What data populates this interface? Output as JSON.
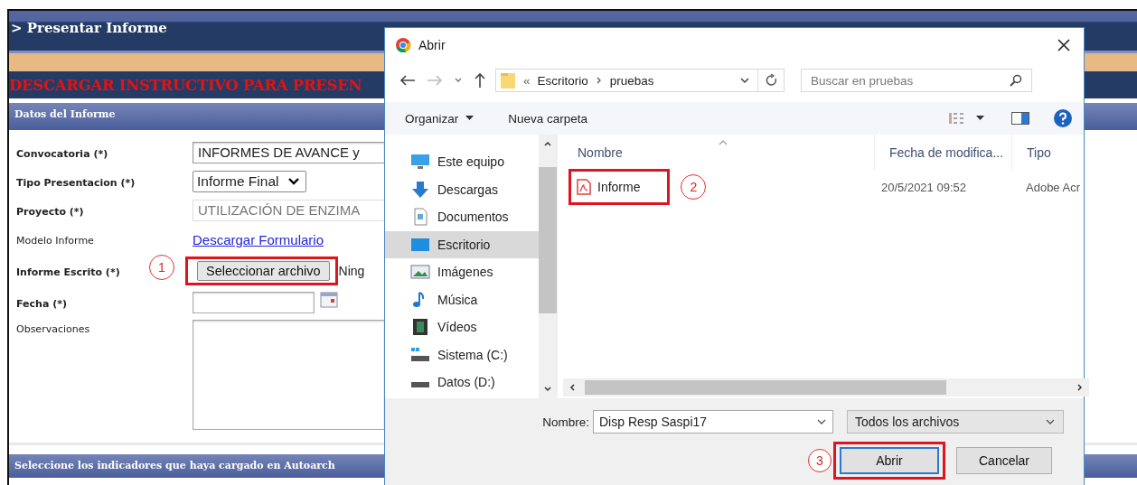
{
  "page": {
    "title": "> Presentar Informe",
    "banner": "DESCARGAR INSTRUCTIVO PARA PRESEN",
    "section": "Datos del Informe",
    "fields": [
      {
        "kind": "text",
        "label": "Convocatoria (*)",
        "bold": true,
        "value": "INFORMES DE AVANCE y"
      },
      {
        "kind": "select",
        "label": "Tipo Presentacion (*)",
        "bold": true,
        "value": "Informe Final"
      },
      {
        "kind": "readonly",
        "label": "Proyecto (*)",
        "bold": true,
        "value": "UTILIZACIÓN DE ENZIMA"
      },
      {
        "kind": "link",
        "label": "Modelo Informe",
        "bold": false,
        "value": "Descargar Formulario"
      },
      {
        "kind": "file",
        "label": "Informe Escrito (*)",
        "bold": true,
        "button": "Seleccionar archivo",
        "value": "Ning"
      },
      {
        "kind": "date",
        "label": "Fecha (*)",
        "bold": true
      },
      {
        "kind": "textarea",
        "label": "Observaciones",
        "bold": false
      }
    ],
    "footer_section": "Seleccione los indicadores que haya cargado en Autoarch"
  },
  "dialog": {
    "title": "Abrir",
    "path_prefix": "«",
    "path": [
      "Escritorio",
      "pruebas"
    ],
    "search": {
      "placeholder": "Buscar en pruebas"
    },
    "toolbar": [
      "Organizar",
      "Nueva carpeta"
    ],
    "sidebar": [
      {
        "kind": "pc",
        "label": "Este equipo",
        "selected": false
      },
      {
        "kind": "download",
        "label": "Descargas",
        "selected": false
      },
      {
        "kind": "docs",
        "label": "Documentos",
        "selected": false
      },
      {
        "kind": "desktop",
        "label": "Escritorio",
        "selected": true
      },
      {
        "kind": "images",
        "label": "Imágenes",
        "selected": false
      },
      {
        "kind": "music",
        "label": "Música",
        "selected": false
      },
      {
        "kind": "videos",
        "label": "Vídeos",
        "selected": false
      },
      {
        "kind": "drive-c",
        "label": "Sistema (C:)",
        "selected": false
      },
      {
        "kind": "drive",
        "label": "Datos (D:)",
        "selected": false
      }
    ],
    "columns": [
      "Nombre",
      "Fecha de modifica...",
      "Tipo"
    ],
    "files": [
      {
        "name": "Informe",
        "date": "20/5/2021 09:52",
        "type": "Adobe Acr"
      }
    ],
    "filename_label": "Nombre:",
    "filename": "Disp Resp Saspi17",
    "filter": "Todos los archivos",
    "buttons": [
      "Abrir",
      "Cancelar"
    ]
  },
  "annotations": [
    {
      "number": "1"
    },
    {
      "number": "2"
    },
    {
      "number": "3"
    }
  ]
}
